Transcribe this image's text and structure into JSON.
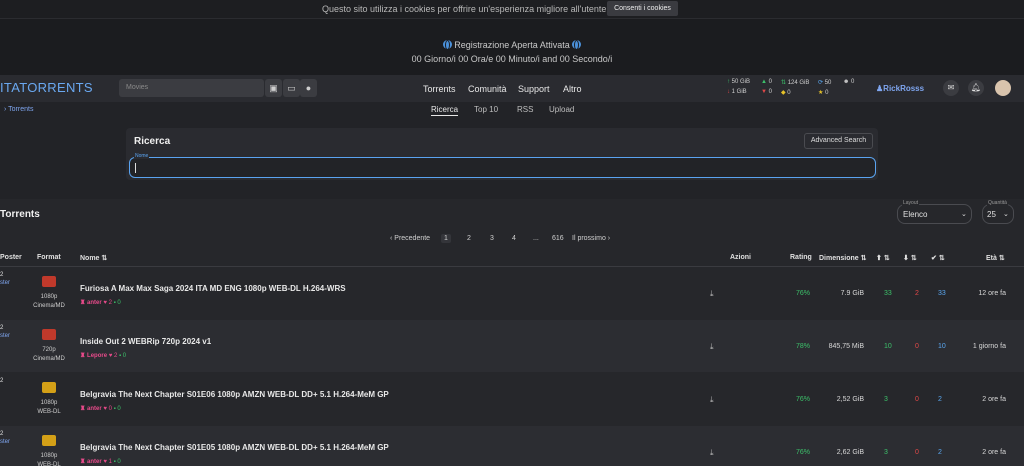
{
  "cookie": {
    "text": "Questo sito utilizza i cookies per offrire un'esperienza migliore all'utente.",
    "button": "Consenti i cookies"
  },
  "banner": {
    "line1": "Registrazione Aperta Attivata",
    "line2": "00 Giorno/i 00 Ora/e 00 Minuto/i and 00 Secondo/i"
  },
  "nav": {
    "logo": "ITATORRENTS",
    "search_placeholder": "Movies",
    "links": [
      "Torrents",
      "Comunità",
      "Support",
      "Altro"
    ],
    "stats": {
      "upload": "50 GiB",
      "download": "1 GiB",
      "seeding": "0",
      "leeching": "0",
      "buffer": "124 GiB",
      "bon": "0",
      "ratio": "50",
      "tips": "0",
      "users": "0"
    },
    "username": "RickRosss"
  },
  "breadcrumb": "Torrents",
  "subnav": [
    "Ricerca",
    "Top 10",
    "RSS",
    "Upload"
  ],
  "search": {
    "title": "Ricerca",
    "advanced": "Advanced Search",
    "field_label": "Nome",
    "value": ""
  },
  "torrents": {
    "title": "Torrents",
    "layout_label": "Layout",
    "layout_value": "Elenco",
    "quantity_label": "Quantità",
    "quantity_value": "25",
    "pagination": {
      "prev": "‹ Precedente",
      "pages": [
        "1",
        "2",
        "3",
        "4",
        "...",
        "616"
      ],
      "next": "Il prossimo ›"
    },
    "headers": {
      "poster": "Poster",
      "format": "Format",
      "name": "Nome ⇅",
      "actions": "Azioni",
      "rating": "Rating",
      "size": "Dimensione ⇅",
      "age": "Età ⇅"
    },
    "rows": [
      {
        "poster": "ster",
        "format": "1080p",
        "category": "Cinema/MD",
        "name": "Furiosa A Max Max Saga 2024 ITA MD ENG 1080p WEB-DL H.264-WRS",
        "uploader": "anter",
        "thanks": "2",
        "comments": "0",
        "rating": "76%",
        "size": "7.9 GiB",
        "seeders": "33",
        "leechers": "2",
        "completed": "33",
        "age": "12 ore fa",
        "icon_color": "#c0392b"
      },
      {
        "poster": "ster",
        "format": "720p",
        "category": "Cinema/MD",
        "name": "Inside Out 2 WEBRip 720p 2024 v1",
        "uploader": "Lepore",
        "thanks": "2",
        "comments": "0",
        "rating": "78%",
        "size": "845,75 MiB",
        "seeders": "10",
        "leechers": "0",
        "completed": "10",
        "age": "1 giorno fa",
        "icon_color": "#c0392b"
      },
      {
        "poster": "",
        "format": "1080p",
        "category": "WEB-DL",
        "name": "Belgravia The Next Chapter S01E06 1080p AMZN WEB-DL DD+ 5.1 H.264-MeM GP",
        "uploader": "anter",
        "thanks": "0",
        "comments": "0",
        "rating": "76%",
        "size": "2,52 GiB",
        "seeders": "3",
        "leechers": "0",
        "completed": "2",
        "age": "2 ore fa",
        "icon_color": "#d4a017"
      },
      {
        "poster": "ster",
        "format": "1080p",
        "category": "WEB-DL",
        "name": "Belgravia The Next Chapter S01E05 1080p AMZN WEB-DL DD+ 5.1 H.264-MeM GP",
        "uploader": "anter",
        "thanks": "1",
        "comments": "0",
        "rating": "76%",
        "size": "2,62 GiB",
        "seeders": "3",
        "leechers": "0",
        "completed": "2",
        "age": "2 ore fa",
        "icon_color": "#d4a017"
      }
    ]
  }
}
